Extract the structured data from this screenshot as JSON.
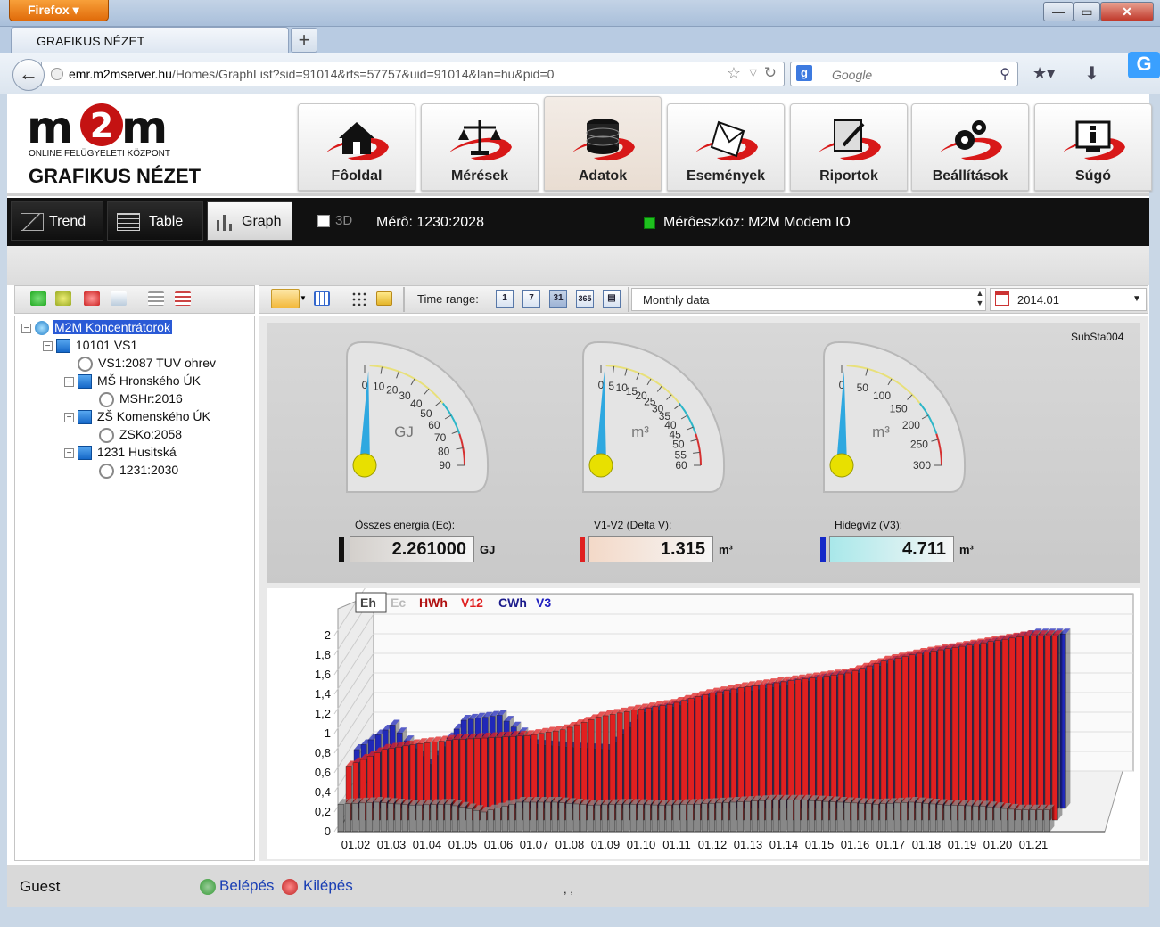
{
  "browser": {
    "app_button": "Firefox",
    "tab_title": "GRAFIKUS NÉZET",
    "new_tab": "+",
    "url_host": "emr.m2mserver.hu",
    "url_path": "/Homes/GraphList?sid=91014&rfs=57757&uid=91014&lan=hu&pid=0",
    "search_placeholder": "Google",
    "search_engine": "g"
  },
  "header": {
    "logo_text": "m2m",
    "slogan": "ONLINE FELÜGYELETI KÖZPONT",
    "page_title": "GRAFIKUS NÉZET",
    "nav": [
      {
        "label": "Fôoldal",
        "icon": "house-icon"
      },
      {
        "label": "Mérések",
        "icon": "scales-icon"
      },
      {
        "label": "Adatok",
        "icon": "database-icon",
        "active": true
      },
      {
        "label": "Események",
        "icon": "envelope-icon"
      },
      {
        "label": "Riportok",
        "icon": "report-icon"
      },
      {
        "label": "Beállítások",
        "icon": "gears-icon"
      },
      {
        "label": "Súgó",
        "icon": "info-icon"
      }
    ]
  },
  "toolbar": {
    "views": [
      {
        "label": "Trend",
        "icon": "trend-icon"
      },
      {
        "label": "Table",
        "icon": "table-icon"
      },
      {
        "label": "Graph",
        "icon": "bar-graph-icon",
        "active": true
      }
    ],
    "label_3d": "3D",
    "mero": "Mérô: 1230:2028",
    "device": "Mérôeszköz: M2M Modem IO"
  },
  "filters": {
    "time_range_label": "Time range:",
    "time_buttons": [
      "1",
      "7",
      "31",
      "365"
    ],
    "data_mode": "Monthly data",
    "date": "2014.01"
  },
  "tree": [
    {
      "label": "M2M Koncentrátorok",
      "level": 0,
      "type": "root",
      "selected": true
    },
    {
      "label": "10101 VS1",
      "level": 1,
      "type": "folder"
    },
    {
      "label": "VS1:2087 TUV ohrev",
      "level": 2,
      "type": "meter"
    },
    {
      "label": "MŠ Hronského ÚK",
      "level": 2,
      "type": "folder"
    },
    {
      "label": "MSHr:2016",
      "level": 3,
      "type": "meter"
    },
    {
      "label": "ZŠ Komenského ÚK",
      "level": 2,
      "type": "folder"
    },
    {
      "label": "ZSKo:2058",
      "level": 3,
      "type": "meter"
    },
    {
      "label": "1231 Husitská",
      "level": 2,
      "type": "folder"
    },
    {
      "label": "1231:2030",
      "level": 3,
      "type": "meter"
    }
  ],
  "gauges": {
    "station": "SubSta004",
    "items": [
      {
        "label": "Összes energia (Ec):",
        "value": "2.261000",
        "unit": "GJ",
        "dial_unit": "GJ",
        "ticks": [
          "0",
          "10",
          "20",
          "30",
          "40",
          "50",
          "60",
          "70",
          "80",
          "90"
        ],
        "max": 90,
        "reading": 2.261,
        "bar_color": "#111111",
        "box_color": "#d4d0cc"
      },
      {
        "label": "V1-V2 (Delta V):",
        "value": "1.315",
        "unit": "m³",
        "dial_unit": "m³",
        "ticks": [
          "0",
          "5",
          "10",
          "15",
          "20",
          "25",
          "30",
          "35",
          "40",
          "45",
          "50",
          "55",
          "60"
        ],
        "max": 60,
        "reading": 1.315,
        "bar_color": "#e02020",
        "box_color": "#f3d9c8"
      },
      {
        "label": "Hidegvíz (V3):",
        "value": "4.711",
        "unit": "m³",
        "dial_unit": "m³",
        "ticks": [
          "0",
          "50",
          "100",
          "150",
          "200",
          "250",
          "300"
        ],
        "max": 300,
        "reading": 4.711,
        "bar_color": "#1428c8",
        "box_color": "#a9e8ea"
      }
    ]
  },
  "chart_data": {
    "type": "bar",
    "legend": [
      {
        "name": "Eh",
        "color": "#444444"
      },
      {
        "name": "Ec",
        "color": "#bbbbbb"
      },
      {
        "name": "HWh",
        "color": "#b01010"
      },
      {
        "name": "V12",
        "color": "#e02020"
      },
      {
        "name": "CWh",
        "color": "#1c1c8c"
      },
      {
        "name": "V3",
        "color": "#2020c0"
      }
    ],
    "y_ticks": [
      "0",
      "0,2",
      "0,4",
      "0,6",
      "0,8",
      "1",
      "1,2",
      "1,4",
      "1,6",
      "1,8",
      "2"
    ],
    "ylim": [
      0,
      2
    ],
    "categories": [
      "01.02",
      "01.03",
      "01.04",
      "01.05",
      "01.06",
      "01.07",
      "01.08",
      "01.09",
      "01.10",
      "01.11",
      "01.12",
      "01.13",
      "01.14",
      "01.15",
      "01.16",
      "01.17",
      "01.18",
      "01.19",
      "01.20",
      "01.21"
    ],
    "series": [
      {
        "name": "Eh",
        "color": "#888888",
        "values": [
          0.28,
          0.3,
          0.27,
          0.28,
          0.2,
          0.3,
          0.3,
          0.27,
          0.28,
          0.27,
          0.28,
          0.3,
          0.32,
          0.32,
          0.3,
          0.28,
          0.3,
          0.27,
          0.26,
          0.22
        ]
      },
      {
        "name": "V12",
        "color": "#e02020",
        "values": [
          0.55,
          0.72,
          0.78,
          0.82,
          0.84,
          0.86,
          0.92,
          1.05,
          1.12,
          1.18,
          1.28,
          1.35,
          1.4,
          1.45,
          1.5,
          1.62,
          1.7,
          1.76,
          1.82,
          1.88
        ]
      },
      {
        "name": "V3",
        "color": "#2028b8",
        "values": [
          0.6,
          0.85,
          0.45,
          0.9,
          0.95,
          0.65,
          0.62,
          0.6,
          0.98,
          1.05,
          1.15,
          1.2,
          1.26,
          1.32,
          1.38,
          1.5,
          1.58,
          1.64,
          1.7,
          1.78
        ]
      }
    ],
    "grid": true
  },
  "footer": {
    "user": "Guest",
    "login": "Belépés",
    "logout": "Kilépés",
    "misc": ", ,"
  }
}
